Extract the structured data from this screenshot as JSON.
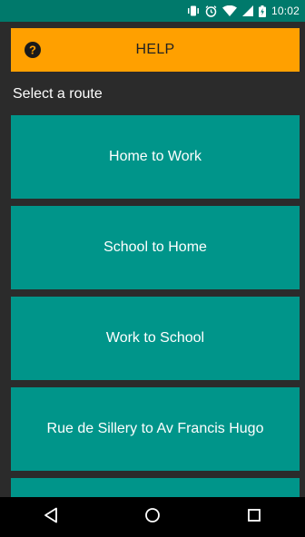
{
  "status_bar": {
    "time": "10:02",
    "icons": [
      "vibrate-icon",
      "alarm-icon",
      "wifi-icon",
      "signal-icon",
      "battery-charging-icon"
    ]
  },
  "help": {
    "label": "HELP",
    "icon": "question-circle-icon"
  },
  "section_title": "Select a route",
  "routes": [
    {
      "label": "Home to Work"
    },
    {
      "label": "School to Home"
    },
    {
      "label": "Work to School"
    },
    {
      "label": "Rue de Sillery to Av Francis Hugo"
    },
    {
      "label": ""
    }
  ],
  "nav_bar": {
    "icons": [
      "back-icon",
      "home-icon",
      "recents-icon"
    ]
  },
  "colors": {
    "status_bar": "#00796b",
    "background": "#2b2b2b",
    "help_bar": "#ffa000",
    "route_button": "#00958a",
    "nav_bar": "#000000"
  }
}
